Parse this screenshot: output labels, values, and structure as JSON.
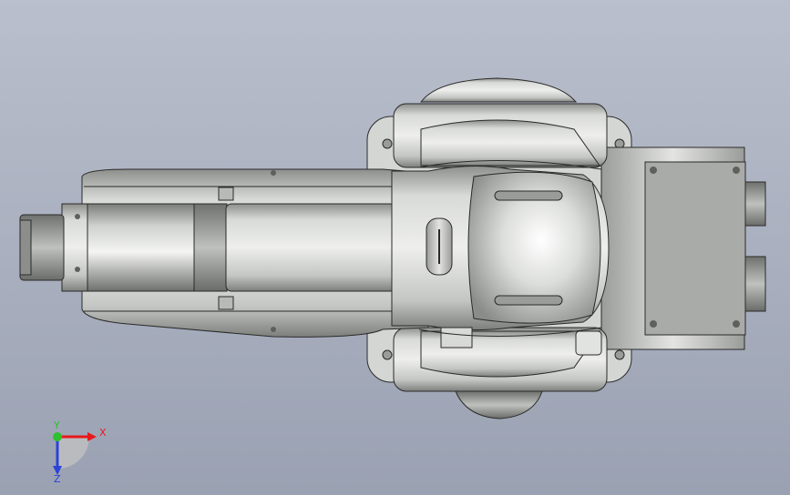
{
  "viewport": {
    "background_top": "#b9bfcc",
    "background_bottom": "#9aa1b2"
  },
  "model": {
    "description_icon": "robot-arm-top-view",
    "body_color": "#c9cbc9",
    "edge_color": "#2a2a2a"
  },
  "triad": {
    "x_label": "X",
    "y_label": "Y",
    "z_label": "Z",
    "x_color": "#e8191a",
    "y_color": "#2ec12e",
    "z_color": "#2a43d8"
  }
}
